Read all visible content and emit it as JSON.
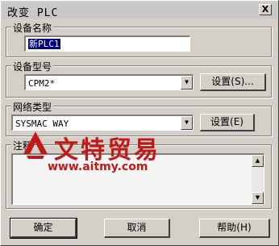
{
  "window": {
    "title": "改变 PLC",
    "close_label": "X"
  },
  "device_name": {
    "label": "设备名称",
    "value": "新PLC1"
  },
  "device_type": {
    "label": "设备型号",
    "value": "CPM2*",
    "settings_label": "设置(S)..."
  },
  "network_type": {
    "label": "网络类型",
    "value": "SYSMAC WAY",
    "settings_label": "设置(E)"
  },
  "comment": {
    "label": "注释",
    "value": ""
  },
  "watermark": {
    "title": "文特贸易",
    "url": "www.aitmy.com"
  },
  "buttons": {
    "ok": "确定",
    "cancel": "取消",
    "help": "帮助(H)"
  },
  "colors": {
    "face": "#d4d0c8",
    "watermark": "#c21818"
  }
}
